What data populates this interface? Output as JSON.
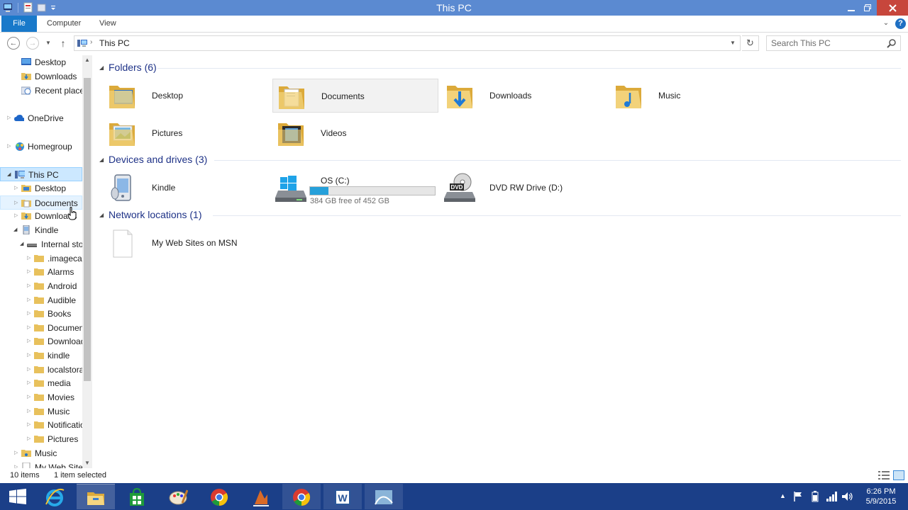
{
  "window": {
    "title": "This PC"
  },
  "ribbon": {
    "tabs": [
      "File",
      "Computer",
      "View"
    ]
  },
  "address": {
    "crumb": "This PC",
    "search_placeholder": "Search This PC"
  },
  "nav_tree": {
    "desktop": "Desktop",
    "downloads": "Downloads",
    "recent": "Recent places",
    "onedrive": "OneDrive",
    "homegroup": "Homegroup",
    "this_pc": "This PC",
    "pc_desktop": "Desktop",
    "pc_documents": "Documents",
    "pc_downloads": "Downloads",
    "kindle": "Kindle",
    "internal_storage": "Internal storage",
    "kindle_folders": [
      "imagecache",
      "Alarms",
      "Android",
      "Audible",
      "Books",
      "Documents",
      "Download",
      "kindle",
      "localstorage",
      "media",
      "Movies",
      "Music",
      "Notifications",
      "Pictures"
    ],
    "kindle_folder_0_display": ".imagecache",
    "music": "Music",
    "my_web_sites": "My Web Sites"
  },
  "groups": {
    "folders": "Folders (6)",
    "devices": "Devices and drives (3)",
    "network": "Network locations (1)"
  },
  "folders": {
    "desktop": "Desktop",
    "documents": "Documents",
    "downloads": "Downloads",
    "music": "Music",
    "pictures": "Pictures",
    "videos": "Videos"
  },
  "devices": {
    "kindle": "Kindle",
    "os_c": "OS (C:)",
    "os_c_free": "384 GB free of 452 GB",
    "os_c_used_fraction": 0.15,
    "dvd": "DVD RW Drive (D:)"
  },
  "network": {
    "msn": "My Web Sites on MSN"
  },
  "status": {
    "items": "10 items",
    "selected": "1 item selected"
  },
  "taskbar": {
    "time": "6:26 PM",
    "date": "5/9/2015"
  },
  "colors": {
    "titlebar": "#5b8ad1",
    "file_tab": "#1979ca",
    "taskbar": "#1b3f88",
    "drive_fill": "#26a0da",
    "group_title": "#1e3287"
  }
}
